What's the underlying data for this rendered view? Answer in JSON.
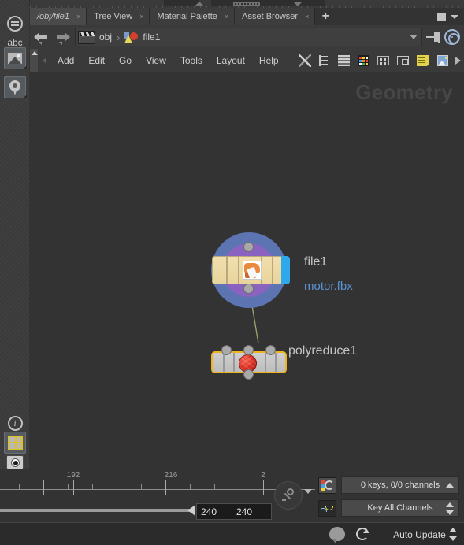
{
  "app": {
    "editor_watermark": "Geometry"
  },
  "tabs": {
    "items": [
      {
        "label": "/obj/file1",
        "close": "×",
        "active": true,
        "italic": true
      },
      {
        "label": "Tree View",
        "close": "×",
        "active": false,
        "italic": false
      },
      {
        "label": "Material Palette",
        "close": "×",
        "active": false,
        "italic": false
      },
      {
        "label": "Asset Browser",
        "close": "×",
        "active": false,
        "italic": false
      }
    ],
    "add_label": "+",
    "maximize_label": "",
    "menu_caret": ""
  },
  "pathbar": {
    "back_title": "Back",
    "forward_title": "Forward",
    "crumb_root": "obj",
    "separator": "›",
    "crumb_current": "file1",
    "dropdown": "",
    "pin": "",
    "target": ""
  },
  "menubar": {
    "items": [
      "Add",
      "Edit",
      "Go",
      "View",
      "Tools",
      "Layout",
      "Help"
    ],
    "tools": [
      "wrench-tool-icon",
      "tree-view-icon",
      "list-lines-icon",
      "color-palette-icon",
      "grid-layout-icon",
      "window-layout-icon",
      "sticky-note-icon",
      "image-sticky-icon",
      "more-tools-icon"
    ]
  },
  "left_rail": {
    "items": [
      {
        "name": "panel-icon",
        "label": ""
      },
      {
        "name": "abc-text-icon",
        "label": "abc"
      },
      {
        "name": "image-plane-icon",
        "label": ""
      },
      {
        "name": "location-pin-icon",
        "label": ""
      },
      {
        "name": "info-icon",
        "label": "ⓘ"
      },
      {
        "name": "grid-window-icon",
        "label": ""
      },
      {
        "name": "eye-view-icon",
        "label": ""
      }
    ]
  },
  "network": {
    "nodes": [
      {
        "id": "file1",
        "label": "file1",
        "sublabel": "motor.fbx",
        "type": "file-sop",
        "selected": false,
        "flag_color": "#2fa8ec",
        "halo_outer": "#5d74b3",
        "halo_inner": "#8a63c0",
        "body_color": "#edd9a3"
      },
      {
        "id": "polyreduce1",
        "label": "polyreduce1",
        "sublabel": "",
        "type": "polyreduce-sop",
        "selected": true,
        "selection_color": "#f0b420",
        "body_color": "#c7c7c7",
        "icon_color": "#e02f22"
      }
    ],
    "connections": [
      {
        "from": "file1",
        "to": "polyreduce1",
        "color": "#9aa86e"
      }
    ]
  },
  "timeline": {
    "tick_labels": [
      "192",
      "216",
      "2"
    ],
    "tick_label_positions": [
      93,
      217,
      334
    ],
    "current_frame": "240",
    "end_frame": "240",
    "key_button": "key-icon",
    "key_dropdown_caret": ""
  },
  "timeline_right": {
    "keys_status": "0 keys, 0/0 channels",
    "key_mode": "Key All Channels",
    "channel_icon": "channel-color-icon",
    "animation_icon": "animation-curve-icon"
  },
  "statusbar": {
    "update_mode": "Auto Update",
    "brain_icon": "cook-brain-icon",
    "refresh_icon": "refresh-icon"
  }
}
